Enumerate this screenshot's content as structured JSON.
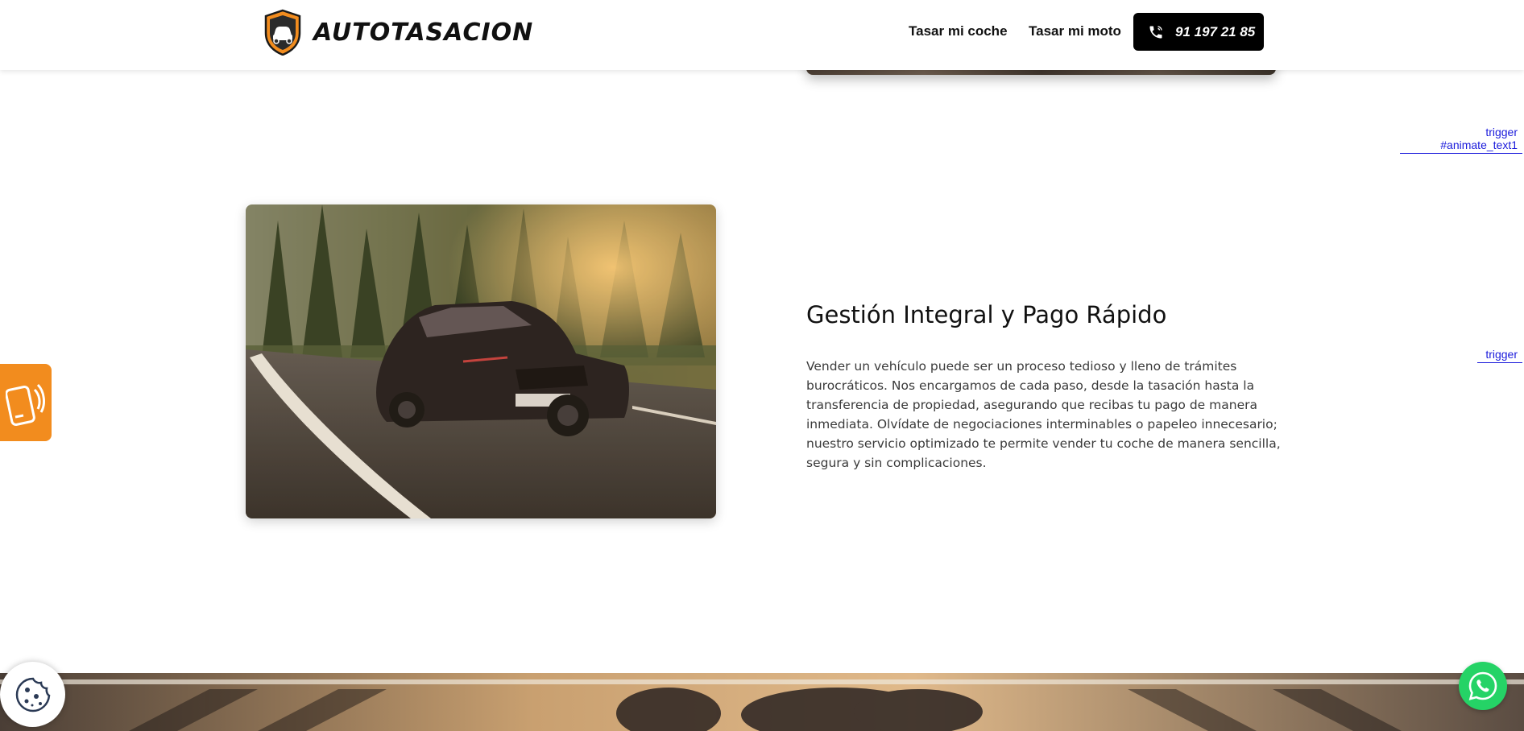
{
  "header": {
    "brand": "AUTOTASACION",
    "nav": [
      {
        "label": "Tasar mi coche"
      },
      {
        "label": "Tasar mi moto"
      }
    ],
    "phone": "91 197 21 85"
  },
  "triggers": {
    "first": "trigger #animate_text1",
    "second": "trigger"
  },
  "section": {
    "title": "Gestión Integral y Pago Rápido",
    "body": "Vender un vehículo puede ser un proceso tedioso y lleno de trámites burocráticos. Nos encargamos de cada paso, desde la tasación hasta la transferencia de propiedad, asegurando que recibas tu pago de manera inmediata. Olvídate de negociaciones interminables o papeleo innecesario; nuestro servicio optimizado te permite vender tu coche de manera sencilla, segura y sin complicaciones."
  },
  "icons": {
    "logo": "shield-car-logo-icon",
    "phone": "phone-icon",
    "mobile": "mobile-phone-icon",
    "cookie": "cookie-icon",
    "whatsapp": "whatsapp-icon"
  },
  "colors": {
    "accent": "#f28c1e",
    "dark": "#000000",
    "link": "#1a1adb",
    "whatsapp": "#25d366"
  }
}
